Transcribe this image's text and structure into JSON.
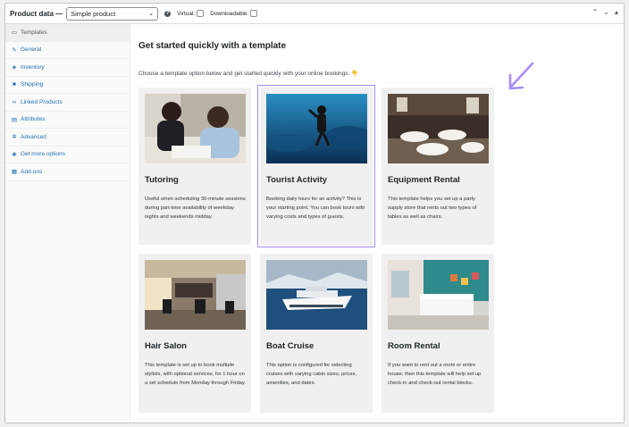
{
  "header": {
    "title": "Product data —",
    "product_type": "Simple product",
    "help": "?",
    "virtual_label": "Virtual:",
    "downloadable_label": "Downloadable:"
  },
  "sidebar": {
    "items": [
      {
        "label": "Templates",
        "icon": "template-icon"
      },
      {
        "label": "General",
        "icon": "wrench-icon"
      },
      {
        "label": "Inventory",
        "icon": "inventory-icon"
      },
      {
        "label": "Shipping",
        "icon": "truck-icon"
      },
      {
        "label": "Linked Products",
        "icon": "link-icon"
      },
      {
        "label": "Attributes",
        "icon": "table-icon"
      },
      {
        "label": "Advanced",
        "icon": "gear-icon"
      },
      {
        "label": "Get more options",
        "icon": "plugin-icon"
      },
      {
        "label": "Add-ons",
        "icon": "addons-icon"
      }
    ]
  },
  "main": {
    "heading": "Get started quickly with a template",
    "intro": "Choose a template option below and get started quickly with your online bookings. 👇",
    "cards": [
      {
        "title": "Tutoring",
        "desc": "Useful when scheduling 30-minute sessions during part-time availability of weekday nights and weekends midday."
      },
      {
        "title": "Tourist Activity",
        "desc": "Booking daily tours for an activity? This is your starting point. You can book tours with varying costs and types of guests."
      },
      {
        "title": "Equipment Rental",
        "desc": "This template helps you set up a party supply store that rents out two types of tables as well as chairs."
      },
      {
        "title": "Hair Salon",
        "desc": "This template is set up to book multiple stylists, with optional services, for 1 hour on a set schedule from Monday through Friday."
      },
      {
        "title": "Boat Cruise",
        "desc": "This option is configured for selecting cruises with varying cabin sizes, prices, amenities, and dates."
      },
      {
        "title": "Room Rental",
        "desc": "If you want to rent out a room or entire house, then this template will help set up check-in and check-out rental blocks."
      }
    ]
  },
  "colors": {
    "link": "#2271b1",
    "highlight": "#a78bfa",
    "card_bg": "#f0f0f0"
  }
}
